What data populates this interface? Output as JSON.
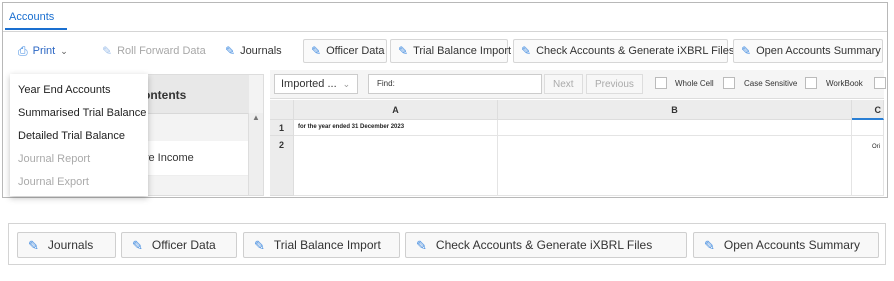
{
  "tabs": {
    "active": "Accounts"
  },
  "toolbar": {
    "print": "Print",
    "roll_forward": "Roll Forward Data",
    "journals": "Journals",
    "officer_data": "Officer Data",
    "trial_balance_import": "Trial Balance Import",
    "check_accounts": "Check Accounts & Generate iXBRL Files",
    "open_summary": "Open Accounts Summary"
  },
  "print_menu": {
    "items": [
      "Year End Accounts",
      "Summarised Trial Balance",
      "Detailed Trial Balance",
      "Journal Report",
      "Journal Export"
    ]
  },
  "contents_panel": {
    "title_fragment": "ontents",
    "row_fragment": "ve Income"
  },
  "sheet": {
    "source_select": "Imported ...",
    "find_label": "Find:",
    "next": "Next",
    "previous": "Previous",
    "whole_cell": "Whole Cell",
    "case_sensitive": "Case Sensitive",
    "workbook": "WorkBook",
    "columns": [
      "A",
      "B",
      "C"
    ],
    "rows": [
      "1",
      "2"
    ],
    "cell_a1": "for the year ended 31 December 2023",
    "cell_c2": "Ori"
  },
  "bottom_bar": {
    "journals": "Journals",
    "officer_data": "Officer Data",
    "trial_balance_import": "Trial Balance Import",
    "check_accounts": "Check Accounts & Generate iXBRL Files",
    "open_summary": "Open Accounts Summary"
  },
  "colors": {
    "accent": "#1a6fd0",
    "icon_blue": "#3f8ae0",
    "active_border": "#2a7fd4"
  },
  "icons": {
    "print": "printer-icon",
    "edit": "edit-square-icon"
  }
}
